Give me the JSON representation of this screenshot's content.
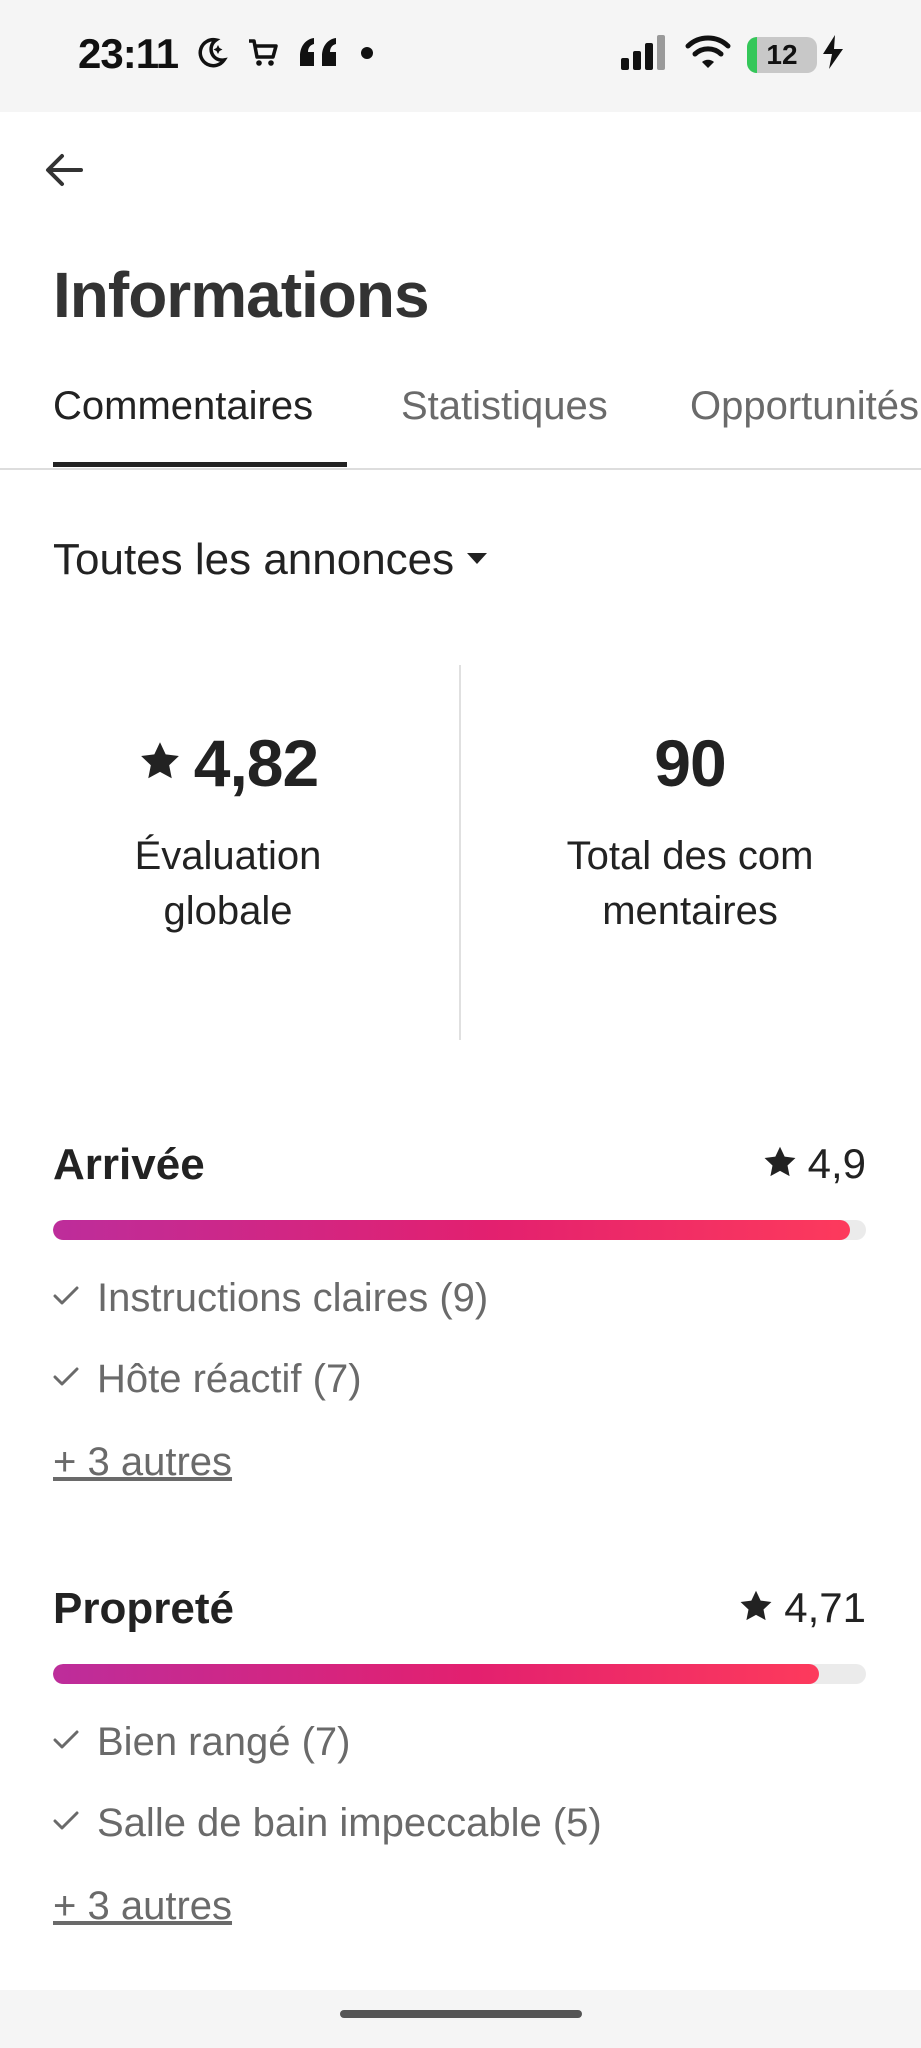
{
  "status_bar": {
    "time": "23:11",
    "battery_level": "12",
    "left_icons": [
      "moon-icon",
      "cart-icon",
      "quote-icon",
      "dot-icon"
    ],
    "right_icons": [
      "signal-icon",
      "wifi-icon",
      "battery-icon",
      "charging-icon"
    ]
  },
  "header": {
    "title": "Informations",
    "back_icon": "arrow-left-icon"
  },
  "tabs": [
    {
      "label": "Commentaires",
      "active": true
    },
    {
      "label": "Statistiques",
      "active": false
    },
    {
      "label": "Opportunités",
      "active": false
    }
  ],
  "filter": {
    "label": "Toutes les annonces",
    "icon": "caret-down-icon"
  },
  "summary": {
    "overall_rating": "4,82",
    "overall_label": "Évaluation globale",
    "total_reviews": "90",
    "total_label": "Total des commentaires"
  },
  "categories": [
    {
      "title": "Arrivée",
      "rating": "4,9",
      "rating_fraction": 0.98,
      "tags": [
        "Instructions claires (9)",
        "Hôte réactif (7)"
      ],
      "more": "+ 3 autres"
    },
    {
      "title": "Propreté",
      "rating": "4,71",
      "rating_fraction": 0.942,
      "tags": [
        "Bien rangé (7)",
        "Salle de bain impeccable (5)"
      ],
      "more": "+ 3 autres"
    }
  ],
  "colors": {
    "bar_gradient_start": "#bd2d9b",
    "bar_gradient_end": "#fd3a5c",
    "text_primary": "#222222",
    "text_secondary": "#6a6a6a"
  }
}
